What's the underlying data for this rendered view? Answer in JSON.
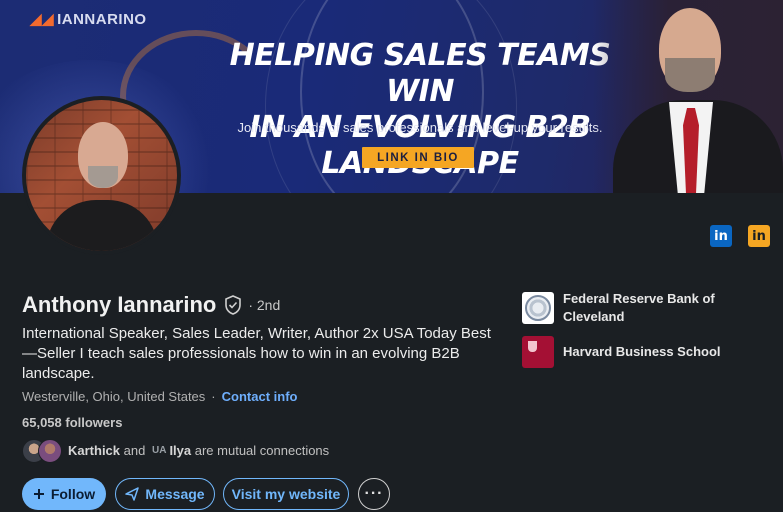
{
  "banner": {
    "brand": "IANNARINO",
    "headline_line1": "HELPING SALES TEAMS WIN",
    "headline_line2": "IN AN EVOLVING B2B LANDSCAPE",
    "subline": "Join thousands of sales professionals and level-up your results.",
    "cta": "LINK IN BIO"
  },
  "social_icons": [
    {
      "icon": "linkedin-icon",
      "text": "in",
      "color": "#0a66c2"
    },
    {
      "icon": "linkedin-icon",
      "text": "in",
      "color": "#f5a623"
    }
  ],
  "profile": {
    "name": "Anthony Iannarino",
    "degree": "· 2nd",
    "headline": "International Speaker, Sales Leader, Writer, Author 2x USA Today Best—Seller I teach sales professionals how to win in an evolving B2B landscape.",
    "location": "Westerville, Ohio, United States",
    "separator": "·",
    "contact_info": "Contact info",
    "followers": "65,058 followers"
  },
  "mutual": {
    "name1": "Karthick",
    "and": "and",
    "ua_badge": "UA",
    "name2": "Ilya",
    "suffix": "are mutual connections"
  },
  "actions": {
    "follow": "Follow",
    "message": "Message",
    "website": "Visit my website",
    "more": "···"
  },
  "organizations": [
    {
      "name": "Federal Reserve Bank of Cleveland"
    },
    {
      "name": "Harvard Business School"
    }
  ],
  "colors": {
    "accent": "#71b7fb",
    "background": "#1b1f23",
    "cta": "#f5a623"
  }
}
